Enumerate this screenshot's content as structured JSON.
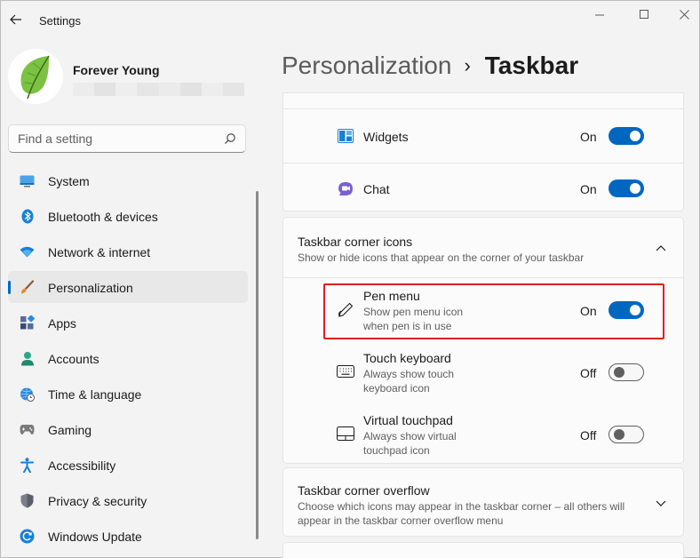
{
  "window": {
    "title": "Settings"
  },
  "profile": {
    "name": "Forever Young"
  },
  "search": {
    "placeholder": "Find a setting"
  },
  "nav": {
    "items": [
      {
        "label": "System",
        "icon": "monitor-icon"
      },
      {
        "label": "Bluetooth & devices",
        "icon": "bluetooth-icon"
      },
      {
        "label": "Network & internet",
        "icon": "wifi-icon"
      },
      {
        "label": "Personalization",
        "icon": "brush-icon",
        "selected": true
      },
      {
        "label": "Apps",
        "icon": "apps-icon"
      },
      {
        "label": "Accounts",
        "icon": "person-icon"
      },
      {
        "label": "Time & language",
        "icon": "globe-clock-icon"
      },
      {
        "label": "Gaming",
        "icon": "gamepad-icon"
      },
      {
        "label": "Accessibility",
        "icon": "accessibility-icon"
      },
      {
        "label": "Privacy & security",
        "icon": "shield-icon"
      },
      {
        "label": "Windows Update",
        "icon": "update-icon"
      }
    ]
  },
  "header": {
    "parent": "Personalization",
    "separator": "›",
    "current": "Taskbar"
  },
  "taskbar_items": {
    "widgets": {
      "label": "Widgets",
      "state": "On",
      "on": true
    },
    "chat": {
      "label": "Chat",
      "state": "On",
      "on": true
    }
  },
  "corner_icons": {
    "title": "Taskbar corner icons",
    "subtitle": "Show or hide icons that appear on the corner of your taskbar",
    "items": [
      {
        "title": "Pen menu",
        "desc1": "Show pen menu icon",
        "desc2": "when pen is in use",
        "state": "On",
        "on": true
      },
      {
        "title": "Touch keyboard",
        "desc1": "Always show touch",
        "desc2": "keyboard icon",
        "state": "Off",
        "on": false
      },
      {
        "title": "Virtual touchpad",
        "desc1": "Always show virtual",
        "desc2": "touchpad icon",
        "state": "Off",
        "on": false
      }
    ]
  },
  "corner_overflow": {
    "title": "Taskbar corner overflow",
    "desc1": "Choose which icons may appear in the taskbar corner – all others will",
    "desc2": "appear in the taskbar corner overflow menu"
  },
  "colors": {
    "accent": "#0067c0",
    "highlight_border": "#e02020",
    "leaf_green": "#7cc242"
  }
}
